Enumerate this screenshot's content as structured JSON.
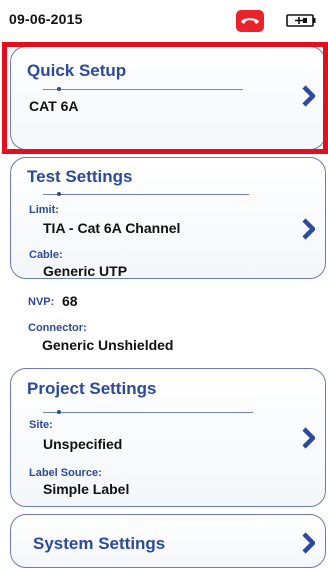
{
  "status": {
    "date": "09-06-2015",
    "phone_icon": "phone-hangup-icon",
    "battery_icon": "battery-plug-icon",
    "phone_color": "#e8242a"
  },
  "quick_setup": {
    "title": "Quick Setup",
    "value": "CAT 6A"
  },
  "test_settings": {
    "title": "Test Settings",
    "limit_label": "Limit:",
    "limit_value": "TIA - Cat 6A Channel",
    "cable_label": "Cable:",
    "cable_value": "Generic UTP",
    "nvp_label": "NVP:",
    "nvp_value": "68",
    "connector_label": "Connector:",
    "connector_value": "Generic Unshielded"
  },
  "project_settings": {
    "title": "Project Settings",
    "site_label": "Site:",
    "site_value": "Unspecified",
    "label_source_label": "Label Source:",
    "label_source_value": "Simple Label"
  },
  "system_settings": {
    "title": "System Settings"
  },
  "colors": {
    "accent_blue": "#2d4a9a",
    "highlight_red": "#e2101e"
  }
}
